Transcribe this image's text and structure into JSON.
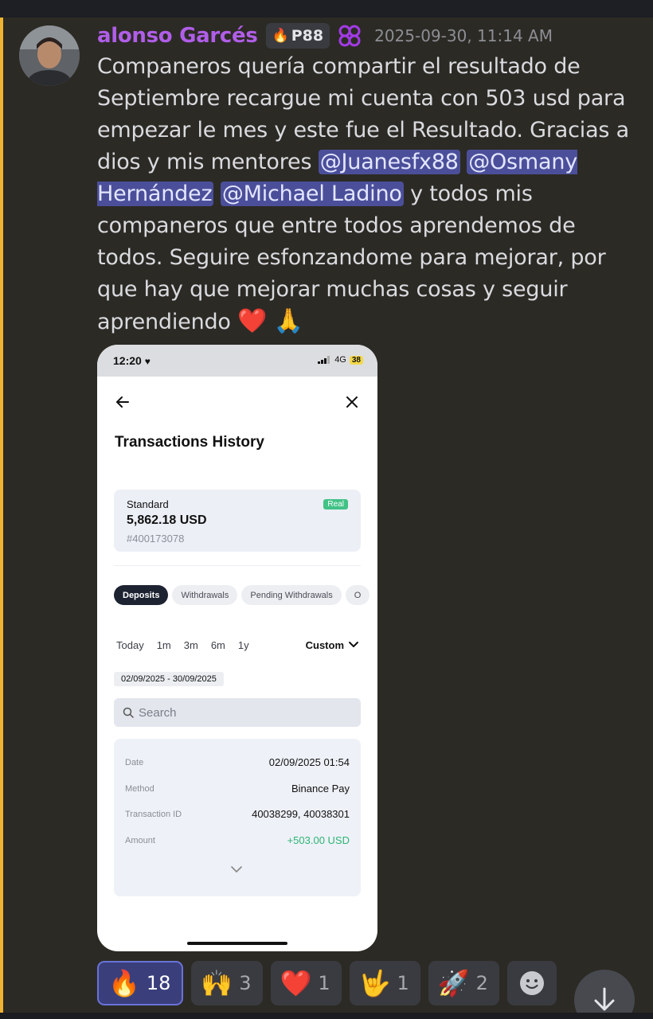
{
  "message": {
    "username": "alonso Garcés",
    "tag": "P88",
    "timestamp": "2025-09-30, 11:14 AM",
    "text": {
      "p1": "Companeros quería compartir el resultado de Septiembre recargue mi cuenta con 503 usd para empezar le mes y este fue el Resultado. Gracias a dios y mis mentores",
      "mention1": "@Juanesfx88",
      "mention2": "@Osmany Hernández",
      "mention3": "@Michael Ladino",
      "p2": "y todos mis companeros que entre todos aprendemos de todos. Seguire esfonzandome para mejorar, por que hay que mejorar muchas cosas y seguir aprendiendo",
      "emoji_heart": "❤️",
      "emoji_pray": "🙏"
    }
  },
  "phone": {
    "status_time": "12:20",
    "network": "4G",
    "battery": "38",
    "title": "Transactions History",
    "account": {
      "name": "Standard",
      "badge": "Real",
      "balance": "5,862.18 USD",
      "number": "#400173078"
    },
    "tabs": [
      "Deposits",
      "Withdrawals",
      "Pending Withdrawals",
      "O"
    ],
    "ranges": [
      "Today",
      "1m",
      "3m",
      "6m",
      "1y"
    ],
    "custom_label": "Custom",
    "date_range": "02/09/2025 - 30/09/2025",
    "search_placeholder": "Search",
    "transaction": {
      "date_label": "Date",
      "date_value": "02/09/2025 01:54",
      "method_label": "Method",
      "method_value": "Binance Pay",
      "id_label": "Transaction ID",
      "id_value": "40038299, 40038301",
      "amount_label": "Amount",
      "amount_value": "+503.00 USD"
    }
  },
  "reactions": [
    {
      "emoji": "🔥",
      "count": "18"
    },
    {
      "emoji": "🙌",
      "count": "3"
    },
    {
      "emoji": "❤️",
      "count": "1"
    },
    {
      "emoji": "🤟",
      "count": "1"
    },
    {
      "emoji": "🚀",
      "count": "2"
    }
  ],
  "colors": {
    "background": "#2c2a25",
    "username": "#b05ee8",
    "mention_bg": "#4b4f9a",
    "highlight_bar": "#f0b232",
    "amount_positive": "#2fb476"
  }
}
